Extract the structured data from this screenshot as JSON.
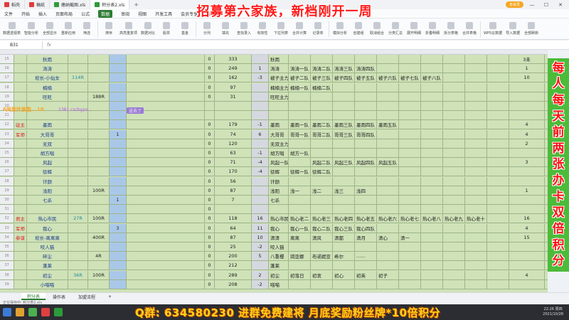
{
  "titlebar": {
    "tabs": [
      {
        "label": "稻壳",
        "color": "#e03b3b",
        "active": false
      },
      {
        "label": "稿纸",
        "color": "#e03b3b",
        "active": false
      },
      {
        "label": "缴纳截图.xls",
        "color": "#2e9b3a",
        "active": false
      },
      {
        "label": "积分表2.xls",
        "color": "#2e9b3a",
        "active": true
      }
    ],
    "plus": "+",
    "user_label": "去会员"
  },
  "banner": "招募第六家族，新档刚开一周",
  "menu": [
    "文件",
    "开始",
    "插入",
    "页面布局",
    "公式",
    "数据",
    "审阅",
    "视图",
    "开发工具",
    "会员专享",
    "效率"
  ],
  "menu_active_index": 5,
  "toolbar": [
    "数据透视表",
    "智能分析",
    "全部显示",
    "重新应用",
    "筛选",
    "排序",
    "高亮重复项",
    "数据对比",
    "股票",
    "基金",
    "分列",
    "填充",
    "查找录入",
    "有效性",
    "下拉列表",
    "合并计算",
    "记录单",
    "模拟分析",
    "创建组",
    "取消组合",
    "分类汇总",
    "展开明细",
    "折叠明细",
    "拆分表格",
    "合并表格",
    "WPS云数据",
    "导入数据",
    "全部刷新"
  ],
  "formula": {
    "cell": "B31",
    "fx": "fx"
  },
  "overlay": {
    "text1": "6闻皆外族能...10",
    "text2": "1381  cscbyps...",
    "text3": "送去了"
  },
  "rows": [
    {
      "n": "15",
      "a": "",
      "b": "秋雨",
      "c": "",
      "d": "",
      "e": "",
      "f": "0",
      "g": "333",
      "h": "",
      "i": "秋雨",
      "cols": [
        "",
        "",
        "",
        "",
        "",
        "",
        "",
        "",
        "",
        ""
      ],
      "x": "3未",
      "y": ""
    },
    {
      "n": "16",
      "a": "",
      "b": "涛涛",
      "c": "",
      "d": "",
      "e": "",
      "f": "0",
      "g": "249",
      "h": "1",
      "i": "涛涛",
      "cols": [
        "涛涛一队",
        "涛涛二队",
        "涛涛三队",
        "涛涛四队",
        "",
        "",
        "",
        "",
        "",
        ""
      ],
      "x": "1",
      "y": ""
    },
    {
      "n": "17",
      "a": "",
      "b": "班长-小仙女",
      "c": "114R",
      "d": "",
      "e": "",
      "f": "0",
      "g": "162",
      "h": "-3",
      "i": "被子主力",
      "cols": [
        "被子二队",
        "被子三队",
        "被子四队",
        "被子五队",
        "被子六队",
        "被子七队",
        "被子八队",
        "",
        "",
        ""
      ],
      "x": "10",
      "y": ""
    },
    {
      "n": "18",
      "a": "",
      "b": "楠楠",
      "c": "",
      "d": "",
      "e": "",
      "f": "0",
      "g": "97",
      "h": "",
      "i": "楠楠主力",
      "cols": [
        "楠楠一队",
        "楠楠二队",
        "",
        "",
        "",
        "",
        "",
        "",
        "",
        ""
      ],
      "x": "",
      "y": ""
    },
    {
      "n": "19",
      "a": "",
      "b": "旺旺",
      "c": "",
      "d": "188R",
      "e": "",
      "f": "0",
      "g": "31",
      "h": "",
      "i": "旺旺主力",
      "cols": [
        "",
        "",
        "",
        "",
        "",
        "",
        "",
        "",
        "",
        ""
      ],
      "x": "",
      "y": ""
    },
    {
      "n": "20",
      "a": "",
      "b": "",
      "c": "",
      "d": "",
      "e": "",
      "f": "",
      "g": "",
      "h": "",
      "i": "",
      "cols": [
        "",
        "",
        "",
        "",
        "",
        "",
        "",
        "",
        "",
        ""
      ],
      "x": "",
      "y": ""
    },
    {
      "n": "21",
      "a": "",
      "b": "",
      "c": "",
      "d": "",
      "e": "",
      "f": "",
      "g": "",
      "h": "",
      "i": "",
      "cols": [
        "",
        "",
        "",
        "",
        "",
        "",
        "",
        "",
        "",
        ""
      ],
      "x": "",
      "y": ""
    },
    {
      "n": "22",
      "a": "驻主",
      "b": "墨雨",
      "c": "",
      "d": "",
      "e": "",
      "f": "0",
      "g": "179",
      "h": "-1",
      "i": "墨雨",
      "cols": [
        "墨雨一队",
        "墨雨二队",
        "墨雨三队",
        "墨雨四队",
        "墨雨五队",
        "",
        "",
        "",
        "",
        ""
      ],
      "x": "4",
      "y": ""
    },
    {
      "n": "23",
      "a": "军师",
      "b": "大哥哥",
      "c": "",
      "d": "",
      "e": "1",
      "f": "0",
      "g": "74",
      "h": "6",
      "i": "大哥哥",
      "cols": [
        "哥哥一队",
        "哥哥二队",
        "哥哥三队",
        "哥哥四队",
        "",
        "",
        "",
        "",
        "",
        ""
      ],
      "x": "4",
      "y": ""
    },
    {
      "n": "24",
      "a": "",
      "b": "无双",
      "c": "",
      "d": "",
      "e": "",
      "f": "0",
      "g": "120",
      "h": "",
      "i": "无双主力",
      "cols": [
        "",
        "",
        "",
        "",
        "",
        "",
        "",
        "",
        "",
        ""
      ],
      "x": "2",
      "y": ""
    },
    {
      "n": "25",
      "a": "",
      "b": "胡方唱",
      "c": "",
      "d": "",
      "e": "",
      "f": "0",
      "g": "63",
      "h": "-1",
      "i": "胡方唱",
      "cols": [
        "胡方一队",
        "",
        "",
        "",
        "",
        "",
        "",
        "",
        "",
        ""
      ],
      "x": "",
      "y": ""
    },
    {
      "n": "26",
      "a": "",
      "b": "风起",
      "c": "",
      "d": "",
      "e": "",
      "f": "0",
      "g": "71",
      "h": "-4",
      "i": "风起一队",
      "cols": [
        "",
        "风起二队",
        "风起三队",
        "风起四队",
        "风起五队",
        "",
        "",
        "",
        "",
        ""
      ],
      "x": "3",
      "y": ""
    },
    {
      "n": "27",
      "a": "",
      "b": "徐辉",
      "c": "",
      "d": "",
      "e": "",
      "f": "0",
      "g": "170",
      "h": "-4",
      "i": "徐辉",
      "cols": [
        "徐辉一队",
        "徐辉二队",
        "",
        "",
        "",
        "",
        "",
        "",
        "",
        ""
      ],
      "x": "",
      "y": ""
    },
    {
      "n": "28",
      "a": "",
      "b": "讦颜",
      "c": "",
      "d": "",
      "e": "",
      "f": "0",
      "g": "56",
      "h": "",
      "i": "讦颜",
      "cols": [
        "",
        "",
        "",
        "",
        "",
        "",
        "",
        "",
        "",
        ""
      ],
      "x": "",
      "y": ""
    },
    {
      "n": "29",
      "a": "",
      "b": "浅阳",
      "c": "",
      "d": "100R",
      "e": "",
      "f": "0",
      "g": "87",
      "h": "",
      "i": "浅阳",
      "cols": [
        "浅一",
        "浅二",
        "浅三",
        "浅四",
        "",
        "",
        "",
        "",
        "",
        ""
      ],
      "x": "1",
      "y": ""
    },
    {
      "n": "30",
      "a": "",
      "b": "七杀",
      "c": "",
      "d": "",
      "e": "1",
      "f": "0",
      "g": "7",
      "h": "",
      "i": "七杀",
      "cols": [
        "",
        "",
        "",
        "",
        "",
        "",
        "",
        "",
        "",
        ""
      ],
      "x": "",
      "y": ""
    },
    {
      "n": "31",
      "a": "",
      "b": "",
      "c": "",
      "d": "",
      "e": "",
      "f": "0",
      "g": "",
      "h": "",
      "i": "",
      "cols": [
        "",
        "",
        "",
        "",
        "",
        "",
        "",
        "",
        "",
        ""
      ],
      "x": "",
      "y": ""
    },
    {
      "n": "32",
      "a": "君主",
      "b": "热心市民",
      "c": "27R",
      "d": "100R",
      "e": "",
      "f": "0",
      "g": "118",
      "h": "16",
      "i": "热心市民",
      "cols": [
        "热心老二",
        "热心老三",
        "热心老四",
        "热心老五",
        "热心老六",
        "热心老七",
        "热心老八",
        "热心老九",
        "热心老十",
        ""
      ],
      "x": "16",
      "y": ""
    },
    {
      "n": "33",
      "a": "军师",
      "b": "我心",
      "c": "",
      "d": "",
      "e": "3",
      "f": "0",
      "g": "64",
      "h": "11",
      "i": "我心",
      "cols": [
        "我心一队",
        "我心二队",
        "我心三队",
        "我心四队",
        "",
        "",
        "",
        "",
        "",
        ""
      ],
      "x": "4",
      "y": ""
    },
    {
      "n": "34",
      "a": "参谋",
      "b": "班长-离离离",
      "c": "",
      "d": "400R",
      "e": "",
      "f": "0",
      "g": "87",
      "h": "10",
      "i": "清清",
      "cols": [
        "离离",
        "清风",
        "清都",
        "清月",
        "清心",
        "清一",
        "",
        "",
        "",
        ""
      ],
      "x": "15",
      "y": "长留"
    },
    {
      "n": "35",
      "a": "",
      "b": "咬人猫",
      "c": "",
      "d": "",
      "e": "",
      "f": "0",
      "g": "25",
      "h": "-2",
      "i": "咬人猫",
      "cols": [
        "",
        "",
        "",
        "",
        "",
        "",
        "",
        "",
        "",
        ""
      ],
      "x": "",
      "y": ""
    },
    {
      "n": "36",
      "a": "",
      "b": "碎尘",
      "c": "",
      "d": "4R",
      "e": "",
      "f": "0",
      "g": "200",
      "h": "5",
      "i": "八重樱",
      "cols": [
        "琪亚娜",
        "布诺妮亚",
        "希尔",
        "……",
        "",
        "",
        "",
        "",
        "",
        ""
      ],
      "x": "",
      "y": ""
    },
    {
      "n": "37",
      "a": "",
      "b": "蓬莱",
      "c": "",
      "d": "",
      "e": "",
      "f": "0",
      "g": "212",
      "h": "",
      "i": "蓬莱",
      "cols": [
        "",
        "",
        "",
        "",
        "",
        "",
        "",
        "",
        "",
        ""
      ],
      "x": "",
      "y": ""
    },
    {
      "n": "38",
      "a": "",
      "b": "初尘",
      "c": "36R",
      "d": "100R",
      "e": "",
      "f": "0",
      "g": "289",
      "h": "2",
      "i": "初尘",
      "cols": [
        "初落日",
        "初衷",
        "初心",
        "初英",
        "初子",
        "",
        "",
        "",
        "",
        ""
      ],
      "x": "4",
      "y": ""
    },
    {
      "n": "39",
      "a": "",
      "b": "小喵喵",
      "c": "",
      "d": "",
      "e": "",
      "f": "0",
      "g": "208",
      "h": "-2",
      "i": "喵喵",
      "cols": [
        "",
        "",
        "",
        "",
        "",
        "",
        "",
        "",
        "",
        ""
      ],
      "x": "",
      "y": ""
    }
  ],
  "vbanner": [
    "每",
    "人",
    "每",
    "天",
    "前",
    "两",
    "张",
    "办",
    "卡",
    "双",
    "倍",
    "积",
    "分"
  ],
  "sheets": [
    "积分表",
    "操作表",
    "加盟流程"
  ],
  "sheet_plus": "+",
  "status": "正在保存中: 积分表2.xls",
  "bottom_banner": "Q群: 634580230 进群免费建将 月底奖励粉丝牌*10倍积分",
  "clock": {
    "time": "22:26 周四",
    "date": "2021/10/28"
  },
  "colors": {
    "grid": "#cfe2b8",
    "blue_col": "#a9c8e8",
    "gray_col": "#d5d9df",
    "banner_red": "#ff1a1a",
    "vbanner_green": "#4cbb3a"
  }
}
